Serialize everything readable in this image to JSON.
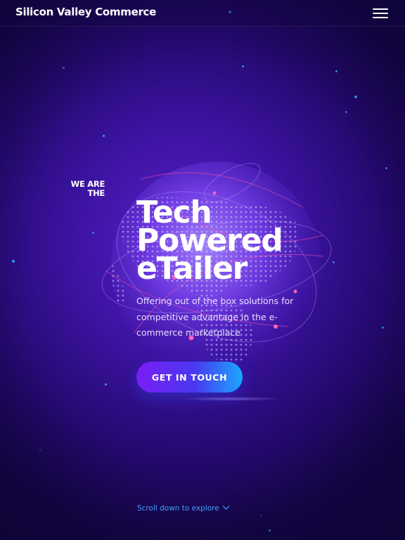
{
  "header": {
    "logo_text": "Silicon Valley Commerce",
    "menu_icon": "hamburger-menu-icon"
  },
  "hero": {
    "kicker_line1": "WE ARE",
    "kicker_line2": "THE",
    "headline_line1": "Tech",
    "headline_line2": "Powered",
    "headline_line3": "eTailer",
    "subtitle": "Offering out of the box solutions for competitive advantage in the e-commerce marketplace",
    "cta_label": "GET IN TOUCH"
  },
  "scroll": {
    "label": "Scroll down to explore",
    "icon": "chevron-down-icon"
  },
  "colors": {
    "background": "#3b13a0",
    "accent_blue": "#3fa3ff",
    "cta_start": "#7a1df5",
    "cta_end": "#1aa8ff",
    "text": "#ffffff"
  }
}
